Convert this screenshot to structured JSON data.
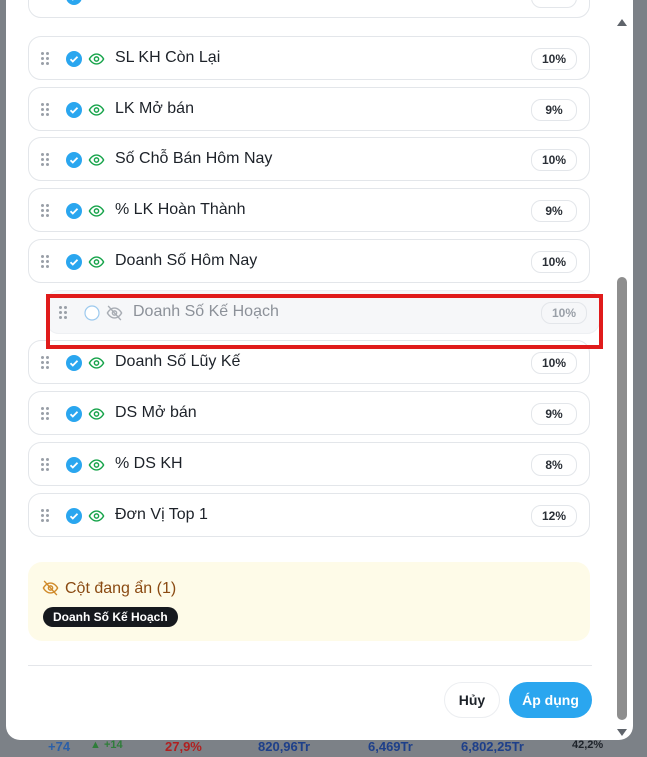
{
  "background": {
    "bottom_values": [
      "+74",
      "▲ +14",
      "27,9%",
      "820,96Tr",
      "6,469Tr",
      "6,802,25Tr",
      "42,2%"
    ]
  },
  "columns": [
    {
      "label": "SL KH Còn Lại",
      "pct": "10%",
      "visible": true
    },
    {
      "label": "LK Mở bán",
      "pct": "9%",
      "visible": true
    },
    {
      "label": "Số Chỗ Bán Hôm Nay",
      "pct": "10%",
      "visible": true
    },
    {
      "label": "% LK Hoàn Thành",
      "pct": "9%",
      "visible": true
    },
    {
      "label": "Doanh Số Hôm Nay",
      "pct": "10%",
      "visible": true
    },
    {
      "label": "Doanh Số Kế Hoạch",
      "pct": "10%",
      "visible": false
    },
    {
      "label": "Doanh Số Lũy Kế",
      "pct": "10%",
      "visible": true
    },
    {
      "label": "DS Mở bán",
      "pct": "9%",
      "visible": true
    },
    {
      "label": "% DS KH",
      "pct": "8%",
      "visible": true
    },
    {
      "label": "Đơn Vị Top 1",
      "pct": "12%",
      "visible": true
    }
  ],
  "hidden_panel": {
    "title": "Cột đang ẩn (1)",
    "chips": [
      "Doanh Số Kế Hoạch"
    ]
  },
  "actions": {
    "cancel_label": "Hủy",
    "apply_label": "Áp dụng"
  },
  "colors": {
    "accent": "#2aa6ef",
    "eye_visible": "#16a34a",
    "highlight_box": "#e01b1b",
    "hidden_panel_bg": "#fefbe8",
    "hidden_panel_text": "#8a4a12"
  }
}
